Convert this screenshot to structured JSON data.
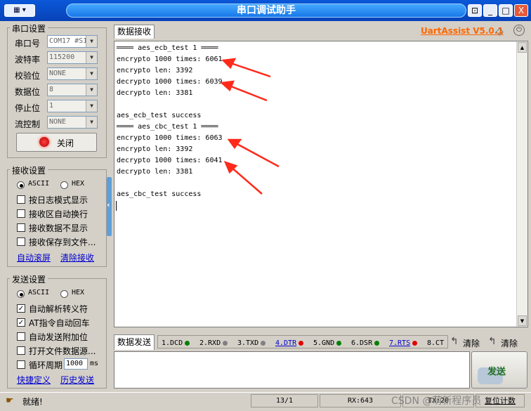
{
  "window": {
    "title": "串口调试助手",
    "menu_label": "▦ ▾",
    "controls": [
      "⊡",
      "_",
      "□",
      "X"
    ]
  },
  "serial_settings": {
    "title": "串口设置",
    "fields": [
      {
        "label": "串口号",
        "value": "COM17 #S1",
        "enabled": true
      },
      {
        "label": "波特率",
        "value": "115200",
        "enabled": false
      },
      {
        "label": "校验位",
        "value": "NONE",
        "enabled": false
      },
      {
        "label": "数据位",
        "value": "8",
        "enabled": false
      },
      {
        "label": "停止位",
        "value": "1",
        "enabled": false
      },
      {
        "label": "流控制",
        "value": "NONE",
        "enabled": false
      }
    ],
    "close_button": "关闭"
  },
  "recv_settings": {
    "title": "接收设置",
    "mode_ascii": "ASCII",
    "mode_hex": "HEX",
    "selected_mode": "ASCII",
    "options": [
      {
        "label": "按日志模式显示",
        "checked": false
      },
      {
        "label": "接收区自动换行",
        "checked": false
      },
      {
        "label": "接收数据不显示",
        "checked": false
      },
      {
        "label": "接收保存到文件...",
        "checked": false
      }
    ],
    "link_autoscroll": "自动滚屏",
    "link_clear": "清除接收"
  },
  "send_settings": {
    "title": "发送设置",
    "mode_ascii": "ASCII",
    "mode_hex": "HEX",
    "selected_mode": "ASCII",
    "options": [
      {
        "label": "自动解析转义符",
        "checked": true
      },
      {
        "label": "AT指令自动回车",
        "checked": true
      },
      {
        "label": "自动发送附加位",
        "checked": false
      },
      {
        "label": "打开文件数据源...",
        "checked": false
      }
    ],
    "cycle_label": "循环周期",
    "cycle_value": "1000",
    "cycle_unit": "ms",
    "link_shortcut": "快捷定义",
    "link_history": "历史发送"
  },
  "receive": {
    "tab_label": "数据接收",
    "brand": "UartAssist V5.0.1",
    "lines": [
      "════ aes_ecb_test 1 ════",
      "encrypto 1000 times: 6061",
      "encrypto len: 3392",
      "decrypto 1000 times: 6039",
      "decrypto len: 3381",
      "",
      "aes_ecb_test success",
      "════ aes_cbc_test 1 ════",
      "encrypto 1000 times: 6063",
      "encrypto len: 3392",
      "decrypto 1000 times: 6041",
      "decrypto len: 3381",
      "",
      "aes_cbc_test success"
    ]
  },
  "send": {
    "tab_label": "数据发送",
    "pins": [
      {
        "label": "1.DCD",
        "color": "#008000",
        "link": false
      },
      {
        "label": "2.RXD",
        "color": "#808080",
        "link": false
      },
      {
        "label": "3.TXD",
        "color": "#808080",
        "link": false
      },
      {
        "label": "4.DTR",
        "color": "#e00000",
        "link": true
      },
      {
        "label": "5.GND",
        "color": "#008000",
        "link": false
      },
      {
        "label": "6.DSR",
        "color": "#008000",
        "link": false
      },
      {
        "label": "7.RTS",
        "color": "#e00000",
        "link": true
      },
      {
        "label": "8.CT",
        "color": "",
        "link": false
      }
    ],
    "clear1": "清除",
    "clear2": "清除",
    "send_button": "发送"
  },
  "status": {
    "text": "就绪!",
    "position": "13/1",
    "rx": "RX:643",
    "tx": "TX:20",
    "reset": "复位计数",
    "watermark": "CSDN @萌新程序员"
  },
  "colors": {
    "accent": "#ff6600",
    "arrow": "#ff2a1a",
    "titlebar": "#0a50d0"
  }
}
